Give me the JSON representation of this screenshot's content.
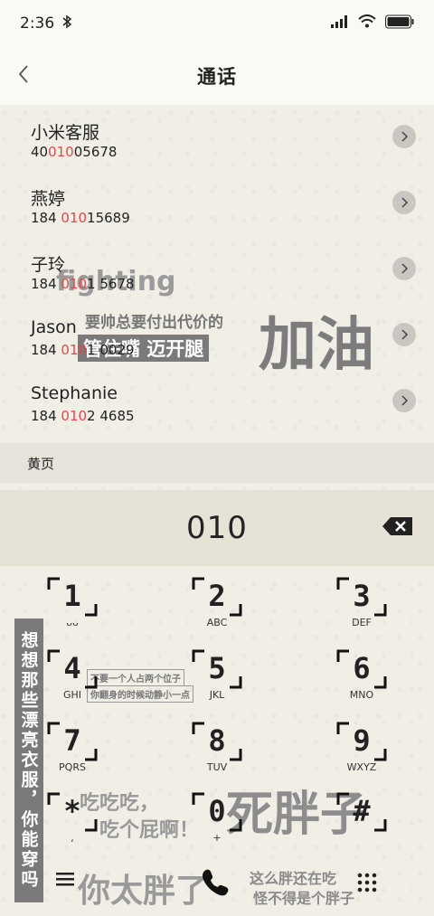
{
  "status": {
    "time": "2:36",
    "bluetooth_icon": "bluetooth-icon",
    "signal_icon": "signal-icon",
    "wifi_icon": "wifi-icon",
    "battery_icon": "battery-icon"
  },
  "header": {
    "title": "通话",
    "back_icon": "chevron-left-icon"
  },
  "contacts": [
    {
      "name": "小米客服",
      "num_pre": "40",
      "num_hl": "010",
      "num_post": "05678"
    },
    {
      "name": "燕婷",
      "num_pre": "184 ",
      "num_hl": "010",
      "num_post": "15689"
    },
    {
      "name": "子玲",
      "num_pre": "184 ",
      "num_hl": "010",
      "num_post": "1 5678"
    },
    {
      "name": "Jason",
      "num_pre": "184 ",
      "num_hl": "010",
      "num_post": "1 0029"
    },
    {
      "name": "Stephanie",
      "num_pre": "184 ",
      "num_hl": "010",
      "num_post": "2 4685"
    }
  ],
  "yellow_pages": "黄页",
  "dialed": "010",
  "keys": [
    {
      "num": "1",
      "letters": "ᴗᴗ"
    },
    {
      "num": "2",
      "letters": "ABC"
    },
    {
      "num": "3",
      "letters": "DEF"
    },
    {
      "num": "4",
      "letters": "GHI"
    },
    {
      "num": "5",
      "letters": "JKL"
    },
    {
      "num": "6",
      "letters": "MNO"
    },
    {
      "num": "7",
      "letters": "PQRS"
    },
    {
      "num": "8",
      "letters": "TUV"
    },
    {
      "num": "9",
      "letters": "WXYZ"
    },
    {
      "num": "*",
      "letters": ","
    },
    {
      "num": "0",
      "letters": "+"
    },
    {
      "num": "#",
      "letters": ""
    }
  ],
  "deco": {
    "fighting": "fighting",
    "line1": "要帅总要付出代价的",
    "line2": "管住嘴  迈开腿",
    "jiayou": "加油",
    "side": "想想那些漂亮衣服，你能穿吗",
    "eat1": "吃吃吃，",
    "eat2": "吃个屁啊！",
    "fat": "死胖子",
    "too_fat": "你太胖了",
    "so_fat1": "这么胖还在吃",
    "so_fat2": "怪不得是个胖子",
    "small1": "不要一个人占两个位子",
    "small2": "你翻身的时候动静小一点"
  },
  "bottom": {
    "menu_icon": "menu-icon",
    "call_icon": "phone-icon",
    "keypad_icon": "dialpad-icon"
  }
}
